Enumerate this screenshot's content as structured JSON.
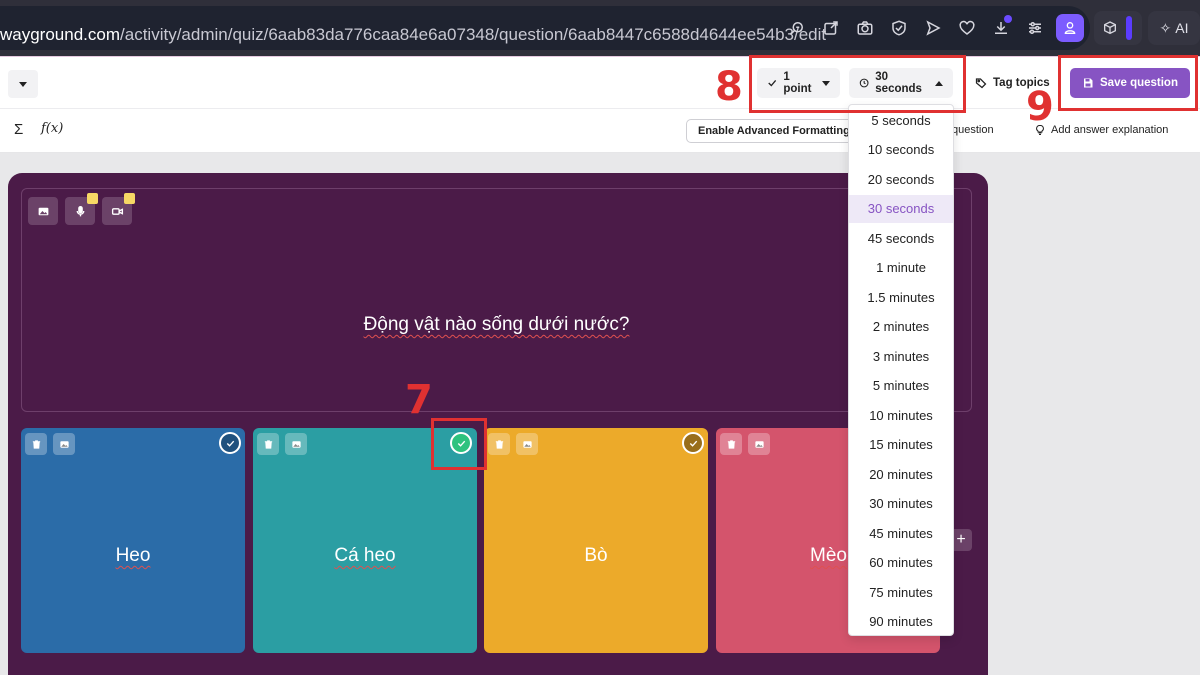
{
  "browser": {
    "url_domain": "wayground.com",
    "url_path": "/activity/admin/quiz/6aab83da776caa84e6a07348/question/6aab8447c6588d4644ee54b3/edit",
    "ai_label": "AI"
  },
  "toolbar": {
    "points_label": "1 point",
    "time_label": "30 seconds",
    "tag_topics_label": "Tag topics",
    "save_label": "Save question"
  },
  "formatting": {
    "sigma_symbol": "Σ",
    "function_symbol": "f(x)",
    "advanced_formatting_label": "Enable Advanced Formatting",
    "question_link": "question",
    "answer_explanation_label": "Add answer explanation"
  },
  "question": {
    "text": "Động vật nào sống dưới nước?"
  },
  "options": [
    {
      "label": "Heo",
      "color": "#2b6ca8",
      "correct": false
    },
    {
      "label": "Cá heo",
      "color": "#2b9ea3",
      "correct": true
    },
    {
      "label": "Bò",
      "color": "#ecaa2a",
      "correct": false
    },
    {
      "label": "Mèo",
      "color": "#d4546c",
      "correct": false
    }
  ],
  "time_dropdown": {
    "selected": "30 seconds",
    "items": [
      "5 seconds",
      "10 seconds",
      "20 seconds",
      "30 seconds",
      "45 seconds",
      "1 minute",
      "1.5 minutes",
      "2 minutes",
      "3 minutes",
      "5 minutes",
      "10 minutes",
      "15 minutes",
      "20 minutes",
      "30 minutes",
      "45 minutes",
      "60 minutes",
      "75 minutes",
      "90 minutes"
    ]
  },
  "annotations": {
    "step_7": "7",
    "step_8": "8",
    "step_9": "9",
    "highlight_color": "#e03131"
  },
  "colors": {
    "accent": "#8754c3",
    "card_bg": "#4b1b48",
    "correct_green": "#2ec27e"
  }
}
